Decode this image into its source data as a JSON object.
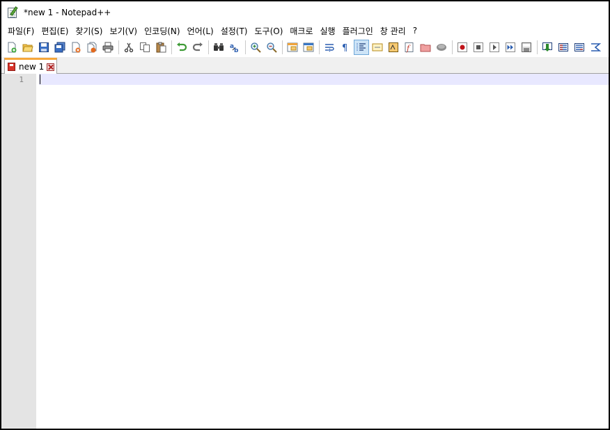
{
  "window": {
    "title": "*new 1 - Notepad++"
  },
  "menubar": {
    "items": [
      {
        "id": "file",
        "label": "파일(F)"
      },
      {
        "id": "edit",
        "label": "편집(E)"
      },
      {
        "id": "search",
        "label": "찾기(S)"
      },
      {
        "id": "view",
        "label": "보기(V)"
      },
      {
        "id": "encoding",
        "label": "인코딩(N)"
      },
      {
        "id": "language",
        "label": "언어(L)"
      },
      {
        "id": "settings",
        "label": "설정(T)"
      },
      {
        "id": "tools",
        "label": "도구(O)"
      },
      {
        "id": "macro",
        "label": "매크로"
      },
      {
        "id": "run",
        "label": "실행"
      },
      {
        "id": "plugins",
        "label": "플러그인"
      },
      {
        "id": "window",
        "label": "창 관리"
      },
      {
        "id": "help",
        "label": "?"
      }
    ]
  },
  "toolbar": {
    "buttons": [
      "new-file-icon",
      "open-file-icon",
      "save-icon",
      "save-all-icon",
      "close-icon",
      "close-all-icon",
      "print-icon",
      "cut-icon",
      "copy-icon",
      "paste-icon",
      "undo-icon",
      "redo-icon",
      "find-icon",
      "replace-icon",
      "zoom-in-icon",
      "zoom-out-icon",
      "sync-vertical-icon",
      "sync-horizontal-icon",
      "word-wrap-icon",
      "show-all-characters-icon",
      "indent-guide-icon",
      "udl-icon",
      "doc-map-icon",
      "function-list-icon",
      "folder-as-workspace-icon",
      "monitoring-icon",
      "record-macro-icon",
      "stop-recording-icon",
      "playback-macro-icon",
      "run-macro-multiple-icon",
      "save-macro-icon",
      "document-list-icon",
      "function-panel-icon",
      "compare-icon",
      "launch-icon"
    ],
    "active": "indent-guide-icon"
  },
  "tabs": [
    {
      "label": "new 1",
      "modified": true
    }
  ],
  "editor": {
    "line_numbers": [
      "1"
    ]
  },
  "colors": {
    "tab_accent": "#f6a73b",
    "current_line": "#e8e8ff",
    "gutter": "#e4e4e4"
  }
}
